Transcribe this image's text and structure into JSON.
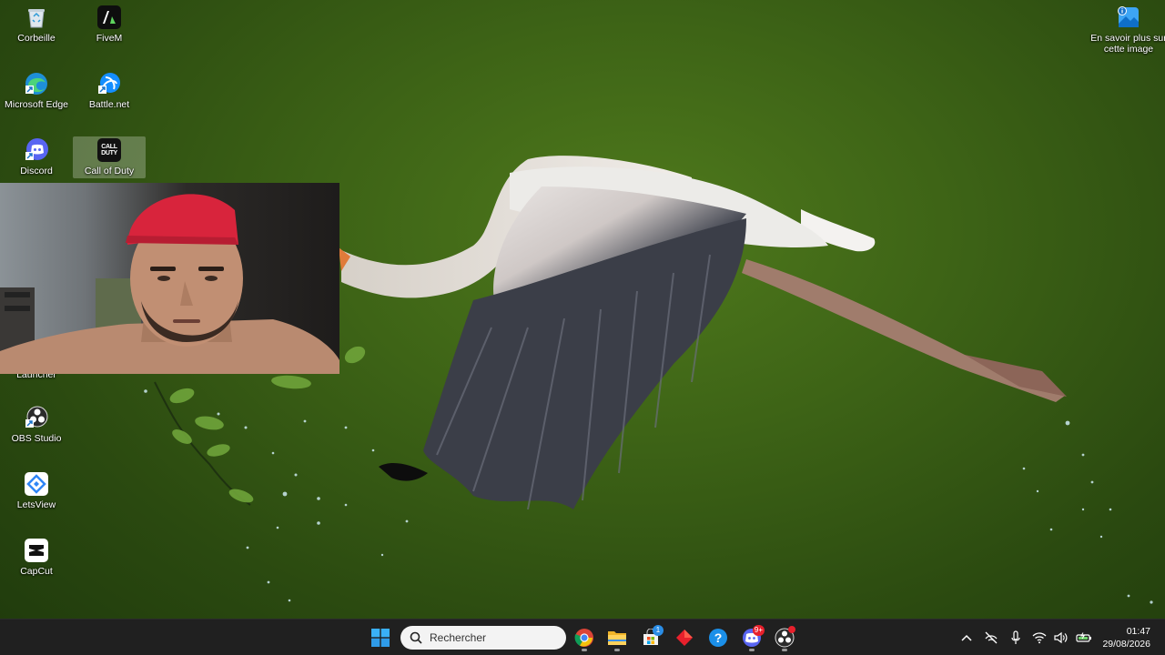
{
  "desktop_icons": [
    {
      "label": "Corbeille",
      "icon": "recycle-bin-icon"
    },
    {
      "label": "FiveM",
      "icon": "fivem-icon"
    },
    {
      "label": "Microsoft Edge",
      "icon": "edge-icon"
    },
    {
      "label": "Battle.net",
      "icon": "battlenet-icon"
    },
    {
      "label": "Discord",
      "icon": "discord-icon"
    },
    {
      "label": "Call of Duty",
      "icon": "call-of-duty-icon",
      "selected": true
    },
    {
      "label": "Launcher",
      "icon": "launcher-icon"
    },
    {
      "label": "OBS Studio",
      "icon": "obs-icon"
    },
    {
      "label": "LetsView",
      "icon": "letsview-icon"
    },
    {
      "label": "CapCut",
      "icon": "capcut-icon"
    }
  ],
  "spotlight": {
    "label": "En savoir plus sur cette image",
    "icon": "spotlight-icon"
  },
  "cod_glyph_text": "CALL DUTY",
  "taskbar": {
    "search_placeholder": "Rechercher",
    "apps": [
      {
        "name": "start",
        "icon": "windows-start-icon"
      },
      {
        "name": "chrome",
        "icon": "chrome-icon"
      },
      {
        "name": "file-explorer",
        "icon": "folder-icon"
      },
      {
        "name": "microsoft-store",
        "icon": "store-icon",
        "badge": "1"
      },
      {
        "name": "app-red",
        "icon": "red-diamond-icon"
      },
      {
        "name": "help",
        "icon": "help-icon"
      },
      {
        "name": "discord",
        "icon": "discord-icon",
        "badge": "9+"
      },
      {
        "name": "obs",
        "icon": "obs-icon"
      }
    ],
    "tray": [
      "chevron-up-icon",
      "network-off-icon",
      "microphone-icon",
      "wifi-icon",
      "volume-icon",
      "battery-icon"
    ],
    "time": "01:47",
    "date": "29/08/2026"
  },
  "colors": {
    "taskbar_bg": "#202020",
    "wallpaper_green": "#3d6316",
    "webcam_cap_red": "#d8243c"
  }
}
